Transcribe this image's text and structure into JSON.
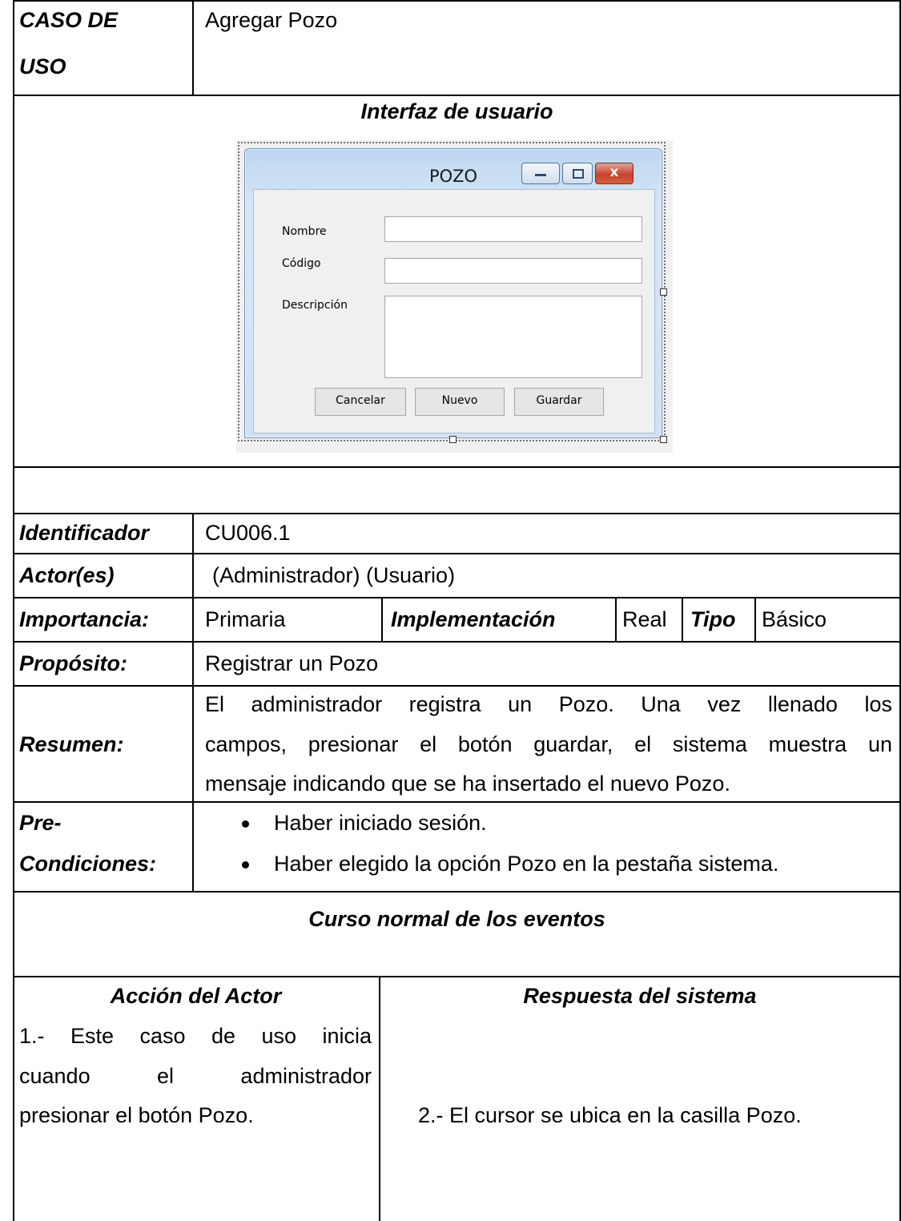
{
  "header": {
    "caso_de_uso_label": "CASO DE USO",
    "caso_de_uso_line1": "CASO DE",
    "caso_de_uso_line2": "USO",
    "caso_de_uso_value": "Agregar Pozo"
  },
  "interfaz": {
    "title": "Interfaz de usuario",
    "window": {
      "title": "POZO",
      "fields": [
        "Nombre",
        "Código",
        "Descripción"
      ],
      "buttons": [
        "Cancelar",
        "Nuevo",
        "Guardar"
      ],
      "icons": [
        "minimize-icon",
        "maximize-icon",
        "close-icon"
      ]
    }
  },
  "details": {
    "identificador_label": "Identificador",
    "identificador_value": "CU006.1",
    "actores_label": "Actor(es)",
    "actores_value": "(Administrador) (Usuario)",
    "importancia_label": "Importancia:",
    "importancia_value": "Primaria",
    "implementacion_label": "Implementación",
    "implementacion_value": "Real",
    "tipo_label": "Tipo",
    "tipo_value": "Básico",
    "proposito_label": "Propósito:",
    "proposito_value": "Registrar un  Pozo",
    "resumen_label": "Resumen:",
    "resumen_lines": [
      "El administrador registra un Pozo. Una vez llenado los",
      "campos,  presionar el botón  guardar, el sistema muestra un",
      "mensaje indicando que  se ha insertado el nuevo  Pozo."
    ],
    "precondiciones_label_1": "Pre-",
    "precondiciones_label_2": "Condiciones:",
    "precondiciones": [
      "Haber iniciado sesión.",
      "Haber elegido la opción  Pozo en  la pestaña sistema."
    ]
  },
  "curso": {
    "title": "Curso normal de los eventos",
    "actor_header": "Acción del Actor",
    "sistema_header": "Respuesta del sistema",
    "actor_lines": [
      "1.- Este caso de uso inicia",
      "cuando el administrador",
      "presionar el botón Pozo."
    ],
    "sistema_step": "2.- El cursor se ubica  en la casilla Pozo."
  }
}
